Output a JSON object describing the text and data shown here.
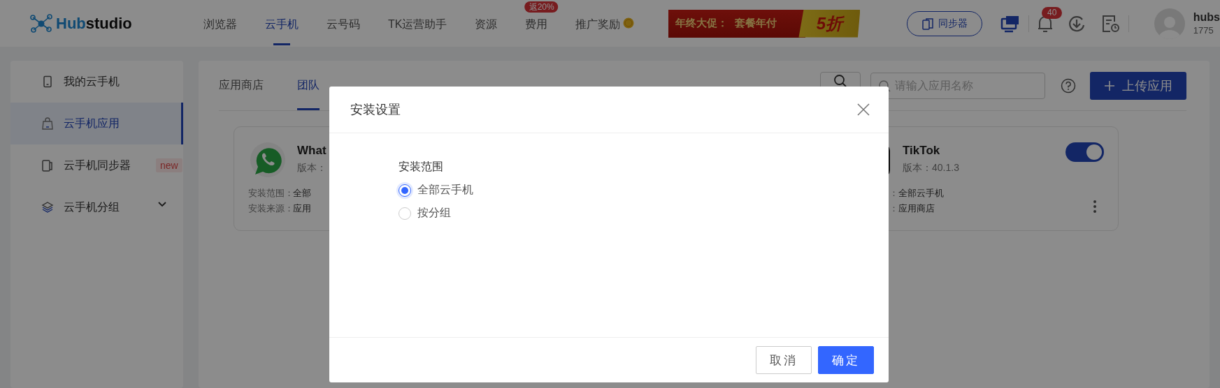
{
  "header": {
    "logo": {
      "prefix": "Hub",
      "suffix": "studio"
    },
    "nav": [
      {
        "label": "浏览器",
        "selected": false
      },
      {
        "label": "云手机",
        "selected": true
      },
      {
        "label": "云号码",
        "selected": false
      },
      {
        "label": "TK运营助手",
        "selected": false
      },
      {
        "label": "资源",
        "selected": false
      },
      {
        "label": "费用",
        "selected": false,
        "badge": "返20%"
      },
      {
        "label": "推广奖励",
        "selected": false,
        "coin": true
      }
    ],
    "promo": {
      "text": "年终大促：",
      "offer": "套餐年付",
      "discount": "5折"
    },
    "sync_button": "同步器",
    "notification_count": "40",
    "user": {
      "name": "hubs",
      "id": "1775"
    }
  },
  "sidebar": {
    "items": [
      {
        "label": "我的云手机",
        "selected": false
      },
      {
        "label": "云手机应用",
        "selected": true
      },
      {
        "label": "云手机同步器",
        "selected": false,
        "badge": "new"
      },
      {
        "label": "云手机分组",
        "selected": false,
        "expandable": true
      }
    ]
  },
  "main": {
    "tabs": [
      {
        "label": "应用商店",
        "selected": false
      },
      {
        "label": "团队",
        "selected": true
      }
    ],
    "search": {
      "placeholder": "请输入应用名称"
    },
    "upload_button": "上传应用",
    "apps": [
      {
        "name": "What",
        "version": "版本：",
        "range_label": "安装范围：",
        "range": "全部",
        "source_label": "安装来源：",
        "source": "应用"
      },
      {
        "name": "TikTok",
        "version": "版本：40.1.3",
        "range_label": "：",
        "range": "全部云手机",
        "source_label": "：",
        "source": "应用商店",
        "enabled": true
      }
    ]
  },
  "dialog": {
    "title": "安装设置",
    "field_label": "安装范围",
    "options": [
      {
        "label": "全部云手机",
        "selected": true
      },
      {
        "label": "按分组",
        "selected": false
      }
    ],
    "buttons": [
      {
        "label": "取消",
        "kind": "secondary"
      },
      {
        "label": "确定",
        "kind": "primary"
      }
    ]
  }
}
